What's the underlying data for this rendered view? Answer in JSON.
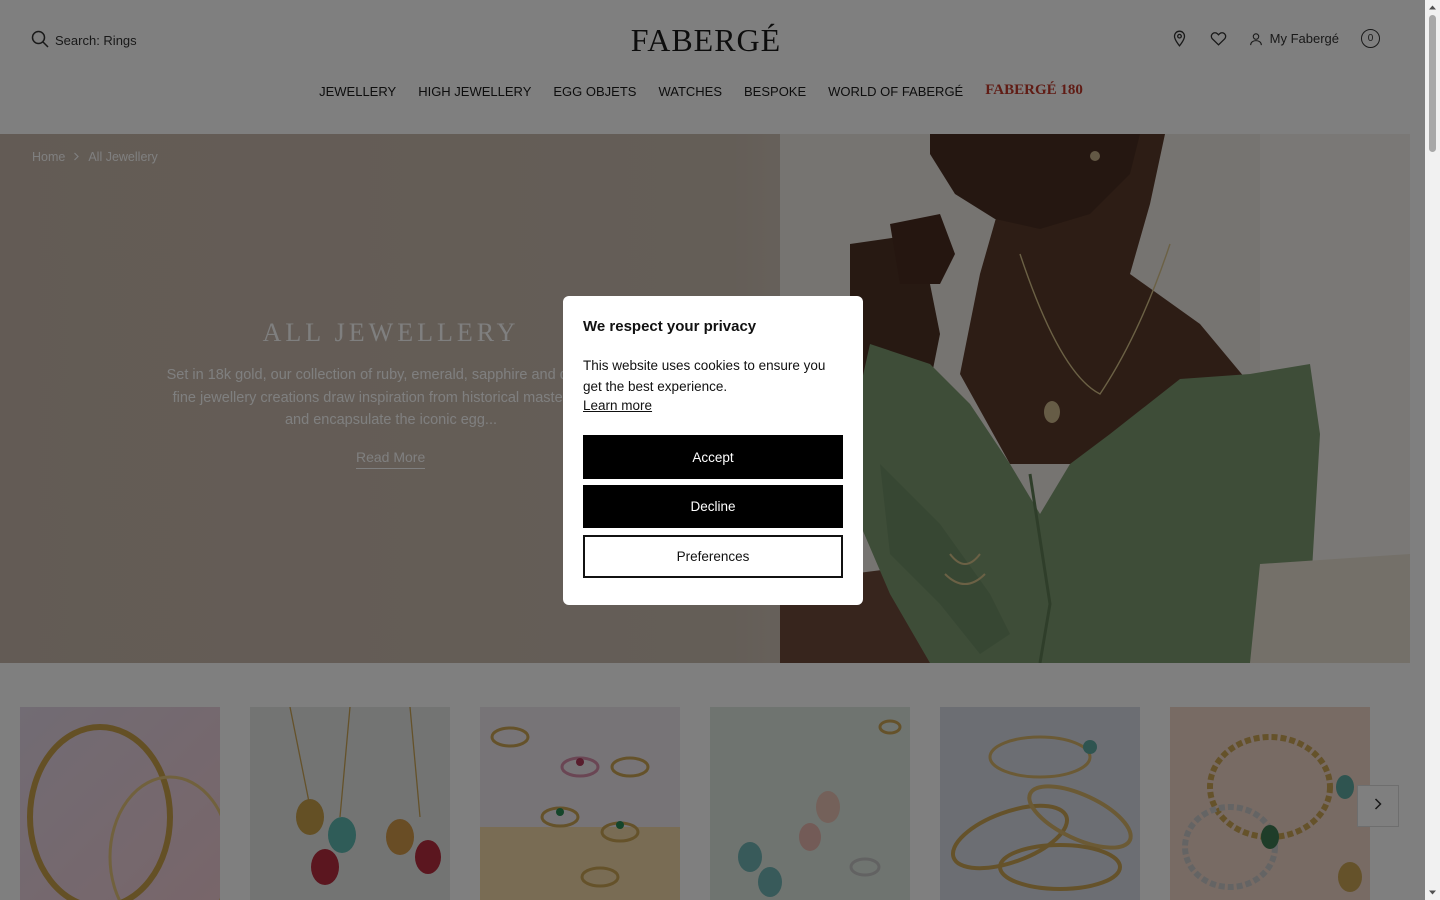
{
  "header": {
    "search_label": "Search: Rings",
    "logo": "FABERGÉ",
    "account_label": "My Fabergé",
    "bag_count": "0"
  },
  "nav": {
    "items": [
      "JEWELLERY",
      "HIGH JEWELLERY",
      "EGG OBJETS",
      "WATCHES",
      "BESPOKE",
      "WORLD OF FABERGÉ"
    ],
    "special": "FABERGÉ 180"
  },
  "breadcrumb": {
    "home": "Home",
    "current": "All Jewellery"
  },
  "hero": {
    "title": "ALL JEWELLERY",
    "description": "Set in 18k gold, our collection of ruby, emerald, sapphire and diamond fine jewellery creations draw inspiration from historical masterpieces and encapsulate the iconic egg...",
    "read_more": "Read More"
  },
  "products": {
    "count": 6,
    "icons": [
      "necklace-image",
      "pendant-image",
      "rings-image",
      "earrings-image",
      "bangles-image",
      "bracelets-image"
    ]
  },
  "cookie_modal": {
    "title": "We respect your privacy",
    "text": "This website uses cookies to ensure you get the best experience.",
    "learn_more": "Learn more",
    "accept": "Accept",
    "decline": "Decline",
    "preferences": "Preferences"
  },
  "colors": {
    "accent_special": "#c0392b",
    "button_dark": "#000000",
    "overlay": "rgba(0,0,0,0.5)"
  }
}
